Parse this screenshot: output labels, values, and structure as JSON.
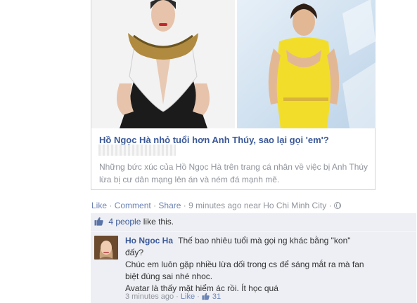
{
  "post": {
    "link_title": "Hồ Ngọc Hà nhỏ tuổi hơn Anh Thúy, sao lại gọi 'em'?",
    "link_description": "Những bức xúc của Hồ Ngọc Hà trên trang cá nhân về việc bị Anh Thúy lừa bị cư dân mạng lên án và ném đá mạnh mẽ.",
    "actions": {
      "like": "Like",
      "comment": "Comment",
      "share": "Share",
      "separator": "·",
      "timestamp": "9 minutes ago near Ho Chi Minh City"
    }
  },
  "likes": {
    "count_text": "4 people",
    "suffix": "like this."
  },
  "comment": {
    "author": "Ho Ngoc Ha",
    "line1": "Thế bao nhiêu tuổi mà gọi ng khác bằng \"kon\" đấy?",
    "line2": "Chúc em luôn gặp nhiều lừa dối trong cs để sáng mắt ra mà fan biệt đúng sai nhé nhoc.",
    "line3": "Avatar là thấy mặt hiểm ác rồi. Ít học quá",
    "time": "3 minutes ago",
    "like": "Like",
    "like_count": "31"
  },
  "colors": {
    "link": "#3b5998",
    "action_link": "#6d84b4",
    "muted": "#90949c",
    "panel_bg": "#edeff4"
  }
}
